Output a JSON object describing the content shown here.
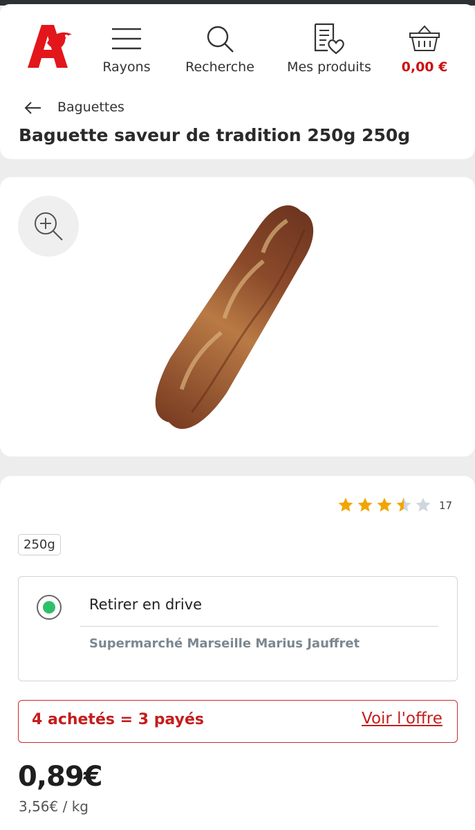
{
  "header": {
    "rayons_label": "Rayons",
    "search_label": "Recherche",
    "products_label": "Mes produits",
    "cart_total": "0,00 €",
    "brand_color": "#e2161b",
    "icons": [
      "auchan-logo-icon",
      "menu-icon",
      "search-icon",
      "shopping-list-heart-icon",
      "basket-icon"
    ]
  },
  "breadcrumb": {
    "label": "Baguettes",
    "icon": "arrow-left-icon"
  },
  "product": {
    "title": "Baguette saveur de tradition 250g 250g",
    "rating": 3.5,
    "rating_max": 5,
    "review_count": "17",
    "weight_option": "250g",
    "price": "0,89€",
    "unit_price": "3,56€ / kg"
  },
  "delivery": {
    "mode_label": "Retirer en drive",
    "store_name": "Supermarché Marseille Marius Jauffret",
    "selected": true
  },
  "offer": {
    "text": "4 achetés = 3 payés",
    "link_label": "Voir l'offre",
    "color": "#c51d1d"
  },
  "zoom": {
    "icon": "zoom-in-icon"
  }
}
